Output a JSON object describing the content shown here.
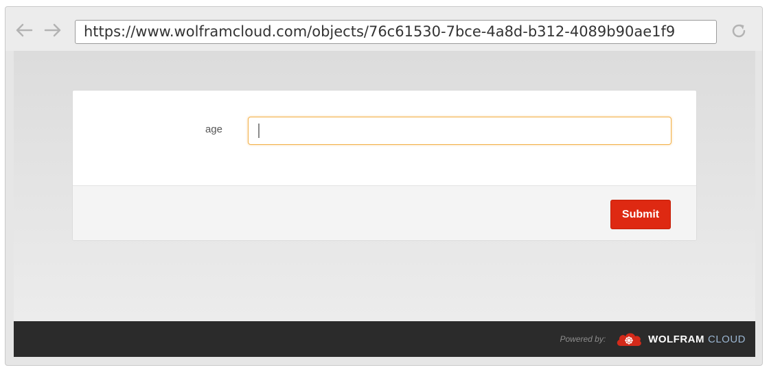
{
  "browser": {
    "url": "https://www.wolframcloud.com/objects/76c61530-7bce-4a8d-b312-4089b90ae1f9",
    "back_icon": "arrow-left-icon",
    "forward_icon": "arrow-right-icon",
    "reload_icon": "reload-icon"
  },
  "form": {
    "field_label": "age",
    "field_value": "",
    "submit_label": "Submit"
  },
  "footer": {
    "powered_by": "Powered by:",
    "brand_primary": "WOLFRAM",
    "brand_secondary": "CLOUD"
  },
  "colors": {
    "submit_bg": "#de2912",
    "footer_bg": "#2b2b2b",
    "input_focus_border": "#f3b24b",
    "brand_secondary": "#9bb6d2"
  }
}
